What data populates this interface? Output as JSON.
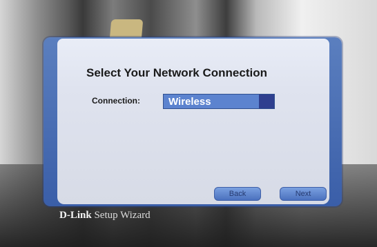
{
  "dialog": {
    "title": "Select Your Network Connection",
    "connection_label": "Connection:",
    "connection_value": "Wireless",
    "back_label": "Back",
    "next_label": "Next"
  },
  "brand": {
    "logo": "D-Link",
    "tagline": "Setup Wizard"
  }
}
